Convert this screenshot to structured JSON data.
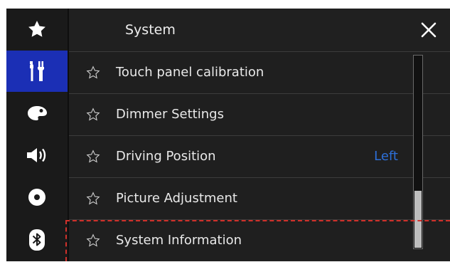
{
  "header": {
    "title": "System"
  },
  "sidebar": {
    "items": [
      {
        "icon": "star-icon"
      },
      {
        "icon": "tools-icon",
        "active": true
      },
      {
        "icon": "palette-icon"
      },
      {
        "icon": "speaker-icon"
      },
      {
        "icon": "disc-icon"
      },
      {
        "icon": "bluetooth-icon"
      }
    ]
  },
  "settings": {
    "items": [
      {
        "label": "Touch panel calibration",
        "value": ""
      },
      {
        "label": "Dimmer Settings",
        "value": ""
      },
      {
        "label": "Driving Position",
        "value": "Left"
      },
      {
        "label": "Picture Adjustment",
        "value": ""
      },
      {
        "label": "System Information",
        "value": ""
      }
    ]
  },
  "colors": {
    "active_tab": "#1b2fb5",
    "value_text": "#2d6fd8",
    "highlight": "#d0302a"
  }
}
